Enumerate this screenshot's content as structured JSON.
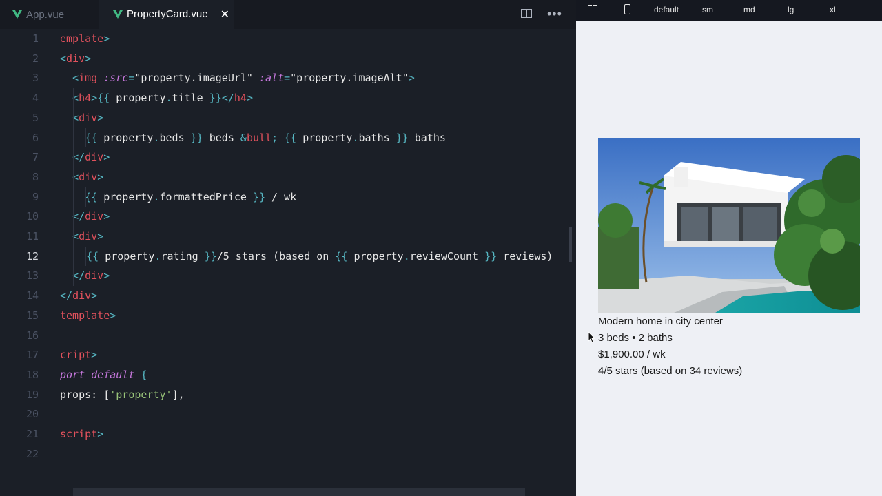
{
  "tabs": [
    {
      "label": "App.vue",
      "active": false
    },
    {
      "label": "PropertyCard.vue",
      "active": true
    }
  ],
  "tab_close_glyph": "✕",
  "editor_actions": {
    "split_icon": "split-editor-icon",
    "more_glyph": "•••"
  },
  "code_lines": [
    {
      "num": "1",
      "tokens": [
        [
          "tag",
          "emplate"
        ],
        [
          "br",
          ">"
        ]
      ]
    },
    {
      "num": "2",
      "tokens": [
        [
          "br",
          "<"
        ],
        [
          "tag",
          "div"
        ],
        [
          "br",
          ">"
        ]
      ]
    },
    {
      "num": "3",
      "tokens": [
        [
          "plain",
          "  "
        ],
        [
          "br",
          "<"
        ],
        [
          "tag",
          "img"
        ],
        [
          "plain",
          " "
        ],
        [
          "attr",
          ":src"
        ],
        [
          "br",
          "="
        ],
        [
          "str",
          "\"property.imageUrl\""
        ],
        [
          "plain",
          " "
        ],
        [
          "attr",
          ":alt"
        ],
        [
          "br",
          "="
        ],
        [
          "str",
          "\"property.imageAlt\""
        ],
        [
          "br",
          ">"
        ]
      ]
    },
    {
      "num": "4",
      "tokens": [
        [
          "plain",
          "  "
        ],
        [
          "br",
          "<"
        ],
        [
          "tag",
          "h4"
        ],
        [
          "br",
          ">"
        ],
        [
          "br",
          "{{"
        ],
        [
          "plain",
          " property"
        ],
        [
          "br",
          "."
        ],
        [
          "plain",
          "title "
        ],
        [
          "br",
          "}}"
        ],
        [
          "br",
          "</"
        ],
        [
          "tag",
          "h4"
        ],
        [
          "br",
          ">"
        ]
      ]
    },
    {
      "num": "5",
      "tokens": [
        [
          "plain",
          "  "
        ],
        [
          "br",
          "<"
        ],
        [
          "tag",
          "div"
        ],
        [
          "br",
          ">"
        ]
      ]
    },
    {
      "num": "6",
      "tokens": [
        [
          "plain",
          "    "
        ],
        [
          "br",
          "{{"
        ],
        [
          "plain",
          " property"
        ],
        [
          "br",
          "."
        ],
        [
          "plain",
          "beds "
        ],
        [
          "br",
          "}}"
        ],
        [
          "plain",
          " beds "
        ],
        [
          "br",
          "&"
        ],
        [
          "tag",
          "bull"
        ],
        [
          "br",
          ";"
        ],
        [
          "plain",
          " "
        ],
        [
          "br",
          "{{"
        ],
        [
          "plain",
          " property"
        ],
        [
          "br",
          "."
        ],
        [
          "plain",
          "baths "
        ],
        [
          "br",
          "}}"
        ],
        [
          "plain",
          " baths"
        ]
      ]
    },
    {
      "num": "7",
      "tokens": [
        [
          "plain",
          "  "
        ],
        [
          "br",
          "</"
        ],
        [
          "tag",
          "div"
        ],
        [
          "br",
          ">"
        ]
      ]
    },
    {
      "num": "8",
      "tokens": [
        [
          "plain",
          "  "
        ],
        [
          "br",
          "<"
        ],
        [
          "tag",
          "div"
        ],
        [
          "br",
          ">"
        ]
      ]
    },
    {
      "num": "9",
      "tokens": [
        [
          "plain",
          "    "
        ],
        [
          "br",
          "{{"
        ],
        [
          "plain",
          " property"
        ],
        [
          "br",
          "."
        ],
        [
          "plain",
          "formattedPrice "
        ],
        [
          "br",
          "}}"
        ],
        [
          "plain",
          " / wk"
        ]
      ]
    },
    {
      "num": "10",
      "tokens": [
        [
          "plain",
          "  "
        ],
        [
          "br",
          "</"
        ],
        [
          "tag",
          "div"
        ],
        [
          "br",
          ">"
        ]
      ]
    },
    {
      "num": "11",
      "tokens": [
        [
          "plain",
          "  "
        ],
        [
          "br",
          "<"
        ],
        [
          "tag",
          "div"
        ],
        [
          "br",
          ">"
        ]
      ]
    },
    {
      "num": "12",
      "current": true,
      "tokens": [
        [
          "plain",
          "    "
        ],
        [
          "cursor",
          ""
        ],
        [
          "br",
          "{{"
        ],
        [
          "plain",
          " property"
        ],
        [
          "br",
          "."
        ],
        [
          "plain",
          "rating "
        ],
        [
          "br",
          "}}"
        ],
        [
          "plain",
          "/5 stars (based on "
        ],
        [
          "br",
          "{{"
        ],
        [
          "plain",
          " property"
        ],
        [
          "br",
          "."
        ],
        [
          "plain",
          "reviewCount "
        ],
        [
          "br",
          "}}"
        ],
        [
          "plain",
          " reviews)"
        ]
      ]
    },
    {
      "num": "13",
      "tokens": [
        [
          "plain",
          "  "
        ],
        [
          "br",
          "</"
        ],
        [
          "tag",
          "div"
        ],
        [
          "br",
          ">"
        ]
      ]
    },
    {
      "num": "14",
      "tokens": [
        [
          "br",
          "</"
        ],
        [
          "tag",
          "div"
        ],
        [
          "br",
          ">"
        ]
      ]
    },
    {
      "num": "15",
      "tokens": [
        [
          "tag",
          "template"
        ],
        [
          "br",
          ">"
        ]
      ]
    },
    {
      "num": "16",
      "tokens": []
    },
    {
      "num": "17",
      "tokens": [
        [
          "tag",
          "cript"
        ],
        [
          "br",
          ">"
        ]
      ]
    },
    {
      "num": "18",
      "tokens": [
        [
          "kw",
          "port default"
        ],
        [
          "plain",
          " "
        ],
        [
          "br",
          "{"
        ]
      ]
    },
    {
      "num": "19",
      "tokens": [
        [
          "plain",
          "props: ["
        ],
        [
          "strg",
          "'property'"
        ],
        [
          "plain",
          "],"
        ]
      ]
    },
    {
      "num": "20",
      "tokens": []
    },
    {
      "num": "21",
      "tokens": [
        [
          "tag",
          "script"
        ],
        [
          "br",
          ">"
        ]
      ]
    },
    {
      "num": "22",
      "tokens": []
    }
  ],
  "preview_toolbar": {
    "expand_icon": "fullscreen-icon",
    "device_icon": "phone-icon",
    "breakpoints": [
      "default",
      "sm",
      "md",
      "lg",
      "xl"
    ]
  },
  "card": {
    "image_alt": "Modern white house with pool and palm trees",
    "title": "Modern home in city center",
    "beds_baths": "3 beds • 2 baths",
    "price": "$1,900.00 / wk",
    "rating": "4/5 stars (based on 34 reviews)"
  }
}
